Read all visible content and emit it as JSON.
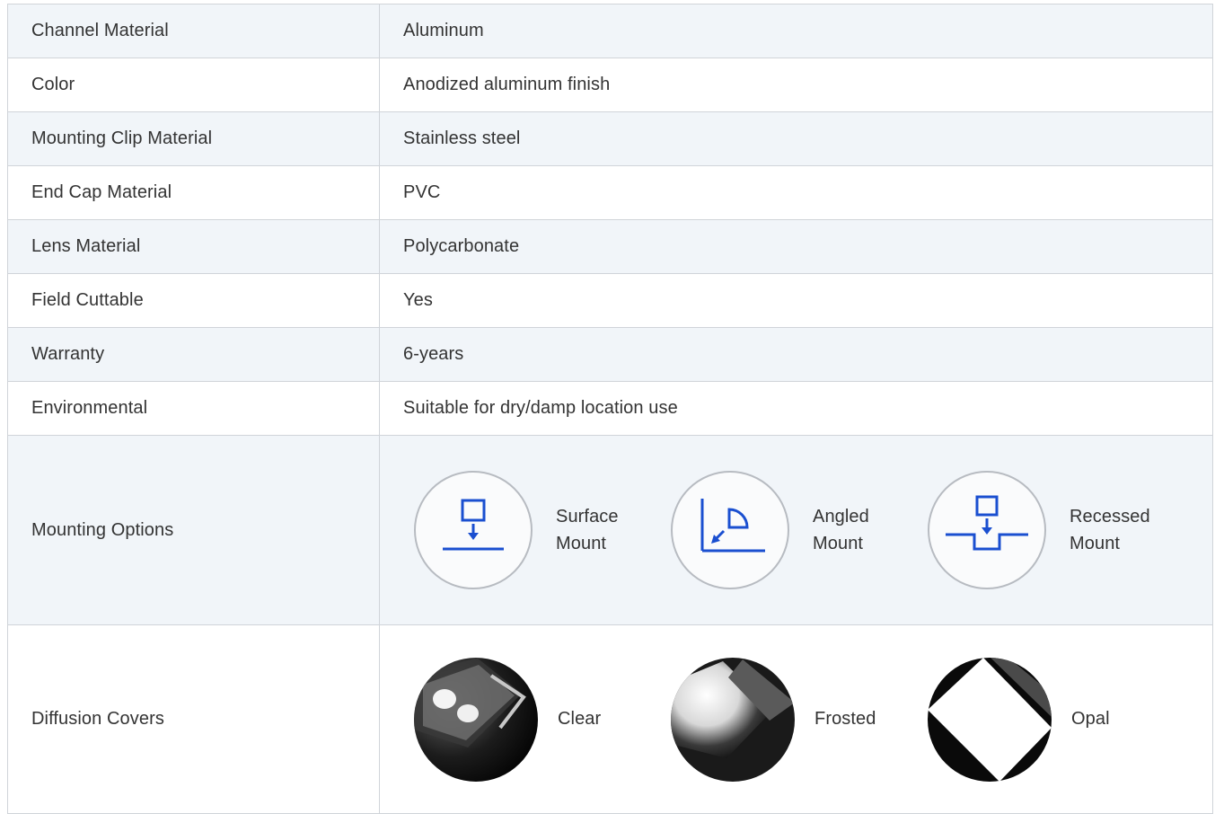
{
  "rows": [
    {
      "label": "Channel Material",
      "value": "Aluminum"
    },
    {
      "label": "Color",
      "value": "Anodized aluminum finish"
    },
    {
      "label": "Mounting Clip Material",
      "value": "Stainless steel"
    },
    {
      "label": "End Cap Material",
      "value": "PVC"
    },
    {
      "label": "Lens Material",
      "value": "Polycarbonate"
    },
    {
      "label": "Field Cuttable",
      "value": "Yes"
    },
    {
      "label": "Warranty",
      "value": "6-years"
    },
    {
      "label": "Environmental",
      "value": "Suitable for dry/damp location use"
    }
  ],
  "mounting": {
    "label": "Mounting Options",
    "options": [
      {
        "line1": "Surface",
        "line2": "Mount",
        "icon": "surface-mount-icon"
      },
      {
        "line1": "Angled",
        "line2": "Mount",
        "icon": "angled-mount-icon"
      },
      {
        "line1": "Recessed",
        "line2": "Mount",
        "icon": "recessed-mount-icon"
      }
    ],
    "icon_color": "#1a4fd0"
  },
  "diffusion": {
    "label": "Diffusion Covers",
    "covers": [
      {
        "name": "Clear",
        "photo": "clear-cover-photo"
      },
      {
        "name": "Frosted",
        "photo": "frosted-cover-photo"
      },
      {
        "name": "Opal",
        "photo": "opal-cover-photo"
      }
    ]
  }
}
